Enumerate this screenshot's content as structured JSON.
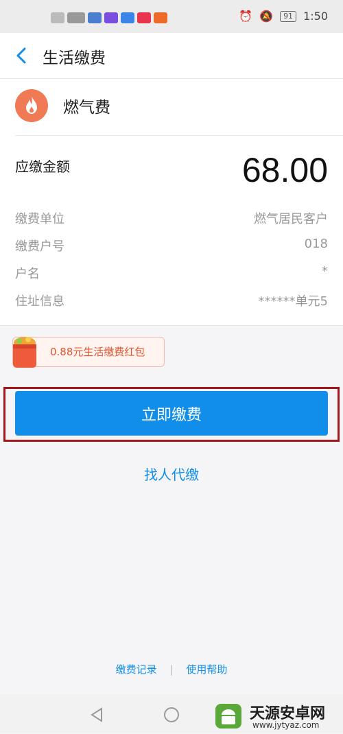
{
  "status": {
    "time": "1:50",
    "battery": "91"
  },
  "header": {
    "title": "生活缴费"
  },
  "biller": {
    "name": "燃气费"
  },
  "amount": {
    "label": "应缴金额",
    "value": "68.00"
  },
  "info": [
    {
      "label": "缴费单位",
      "value": "燃气居民客户"
    },
    {
      "label": "缴费户号",
      "value": "018"
    },
    {
      "label": "户名",
      "value": "*"
    },
    {
      "label": "住址信息",
      "value": "******单元5"
    }
  ],
  "promo": {
    "text": "0.88元生活缴费红包"
  },
  "actions": {
    "pay": "立即缴费",
    "proxy": "找人代缴"
  },
  "footer": {
    "records": "缴费记录",
    "help": "使用帮助"
  },
  "watermark": {
    "brand": "天源安卓网",
    "url": "www.jytyaz.com"
  },
  "colors": {
    "accent": "#108ee9",
    "highlight_frame": "#a3171b",
    "gas_icon": "#f07a55",
    "promo": "#e4532e"
  }
}
